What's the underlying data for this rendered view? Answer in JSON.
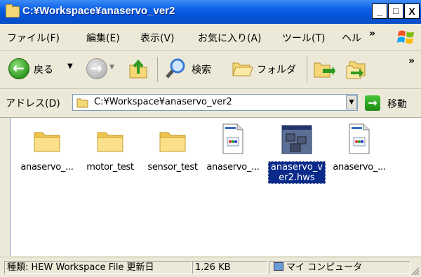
{
  "window": {
    "title": "C:¥Workspace¥anaservo_ver2"
  },
  "title_buttons": {
    "minimize": "_",
    "maximize": "□",
    "close": "X"
  },
  "menu": {
    "items": [
      "ファイル(F)",
      "編集(E)",
      "表示(V)",
      "お気に入り(A)",
      "ツール(T)",
      "ヘル"
    ],
    "overflow": "»"
  },
  "toolbar": {
    "back": "戻る",
    "search": "検索",
    "folders": "フォルダ",
    "overflow": "»"
  },
  "address": {
    "label": "アドレス(D)",
    "value": "C:¥Workspace¥anaservo_ver2",
    "go": "移動"
  },
  "files": [
    {
      "name": "anaservo_...",
      "type": "folder"
    },
    {
      "name": "motor_test",
      "type": "folder"
    },
    {
      "name": "sensor_test",
      "type": "folder"
    },
    {
      "name": "anaservo_...",
      "type": "document"
    },
    {
      "name_line1": "anaservo_v",
      "name_line2": "er2.hws",
      "type": "workspace",
      "selected": true
    },
    {
      "name": "anaservo_...",
      "type": "document"
    }
  ],
  "status": {
    "type": "種類: HEW Workspace File 更新日",
    "size": "1.26 KB",
    "location": "マイ コンピュータ"
  }
}
